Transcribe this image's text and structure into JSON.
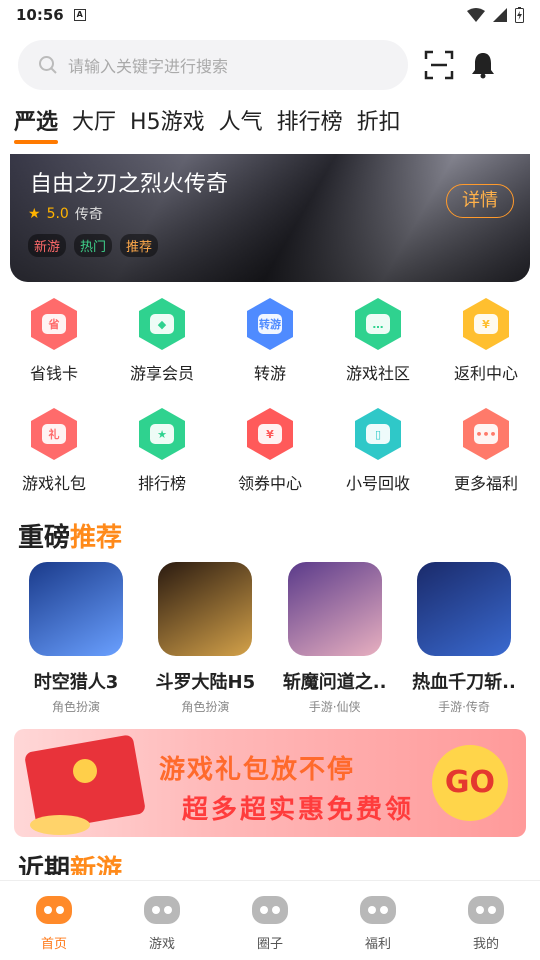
{
  "status": {
    "time": "10:56",
    "badge": "A"
  },
  "search": {
    "placeholder": "请输入关键字进行搜索"
  },
  "tabs": [
    "严选",
    "大厅",
    "H5游戏",
    "人气",
    "排行榜",
    "折扣"
  ],
  "banner": {
    "title": "自由之刃之烈火传奇",
    "rating": "5.0",
    "genre": "传奇",
    "tags": [
      "新游",
      "热门",
      "推荐"
    ],
    "detail_label": "详情"
  },
  "grid": [
    {
      "label": "省钱卡",
      "icon": "savings-card-icon",
      "color": "#ff6b6b",
      "glyph": "省"
    },
    {
      "label": "游享会员",
      "icon": "diamond-icon",
      "color": "#2fd28f",
      "glyph": "◆"
    },
    {
      "label": "转游",
      "icon": "transfer-game-icon",
      "color": "#4f8bff",
      "glyph": "转游"
    },
    {
      "label": "游戏社区",
      "icon": "community-chat-icon",
      "color": "#2fd28f",
      "glyph": "…"
    },
    {
      "label": "返利中心",
      "icon": "rebate-icon",
      "color": "#ffbf2f",
      "glyph": "¥"
    },
    {
      "label": "游戏礼包",
      "icon": "gift-pack-icon",
      "color": "#ff6b6b",
      "glyph": "礼"
    },
    {
      "label": "排行榜",
      "icon": "trophy-icon",
      "color": "#2fd28f",
      "glyph": "★"
    },
    {
      "label": "领券中心",
      "icon": "coupon-icon",
      "color": "#ff5a5a",
      "glyph": "¥"
    },
    {
      "label": "小号回收",
      "icon": "phone-recycle-icon",
      "color": "#2fc8c8",
      "glyph": "▯"
    },
    {
      "label": "更多福利",
      "icon": "more-welfare-icon",
      "color": "#ff7a6a",
      "glyph": "•••"
    }
  ],
  "section_recommend": {
    "part1": "重磅",
    "part2": "推荐"
  },
  "games": [
    {
      "name": "时空猎人3",
      "category": "角色扮演",
      "colors": [
        "#1a3a8a",
        "#6aa0ff"
      ]
    },
    {
      "name": "斗罗大陆H5",
      "category": "角色扮演",
      "colors": [
        "#2a1a10",
        "#d4a24a"
      ]
    },
    {
      "name": "斩魔问道之..",
      "category": "手游·仙侠",
      "colors": [
        "#5a3a8a",
        "#e8b0c0"
      ]
    },
    {
      "name": "热血千刀斩..",
      "category": "手游·传奇",
      "colors": [
        "#1a2a6a",
        "#3a6ad0"
      ]
    }
  ],
  "ad": {
    "line1": "游戏礼包放不停",
    "line2": "超多超实惠免费领",
    "go": "GO"
  },
  "section_new": {
    "part1": "近期",
    "part2": "新游"
  },
  "nav": [
    {
      "label": "首页",
      "icon": "home-gamepad-icon",
      "active": true
    },
    {
      "label": "游戏",
      "icon": "game-heart-icon",
      "active": false
    },
    {
      "label": "圈子",
      "icon": "circle-chat-icon",
      "active": false
    },
    {
      "label": "福利",
      "icon": "welfare-gift-icon",
      "active": false
    },
    {
      "label": "我的",
      "icon": "profile-face-icon",
      "active": false
    }
  ]
}
